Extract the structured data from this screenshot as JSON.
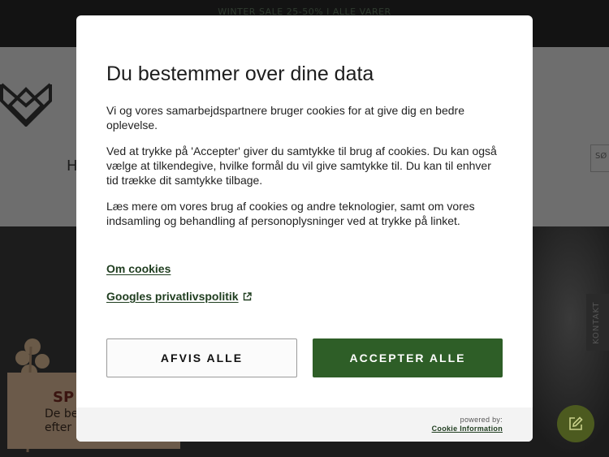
{
  "background": {
    "promo_text": "WINTER SALE 25-50% I ALLE VARER",
    "header_text": "H",
    "header_right_text": "SØ",
    "spot_title": "SP",
    "spot_text_line1": "De be",
    "spot_text_line2": "efter",
    "kontakt_label": "KONTAKT",
    "edit_icon": "pencil-square-icon"
  },
  "modal": {
    "title": "Du bestemmer over dine data",
    "paragraph1": "Vi og vores samarbejdspartnere bruger cookies for at give dig en bedre oplevelse.",
    "paragraph2": "Ved at trykke på 'Accepter' giver du samtykke til brug af cookies. Du kan også vælge at tilkendegive, hvilke formål du vil give samtykke til. Du kan til enhver tid trække dit samtykke tilbage.",
    "paragraph3": "Læs mere om vores brug af cookies og andre teknologier, samt om vores indsamling og behandling af personoplysninger ved at trykke på linket.",
    "link_cookies": "Om cookies",
    "link_google": "Googles privatlivspolitik",
    "external_icon": "external-link-icon",
    "reject_label": "AFVIS ALLE",
    "accept_label": "ACCEPTER ALLE",
    "powered_by": "powered by:",
    "provider": "Cookie Information"
  },
  "colors": {
    "accent": "#2e5e27",
    "link": "#1f3d1f",
    "edit_button": "#4c5a1f"
  }
}
